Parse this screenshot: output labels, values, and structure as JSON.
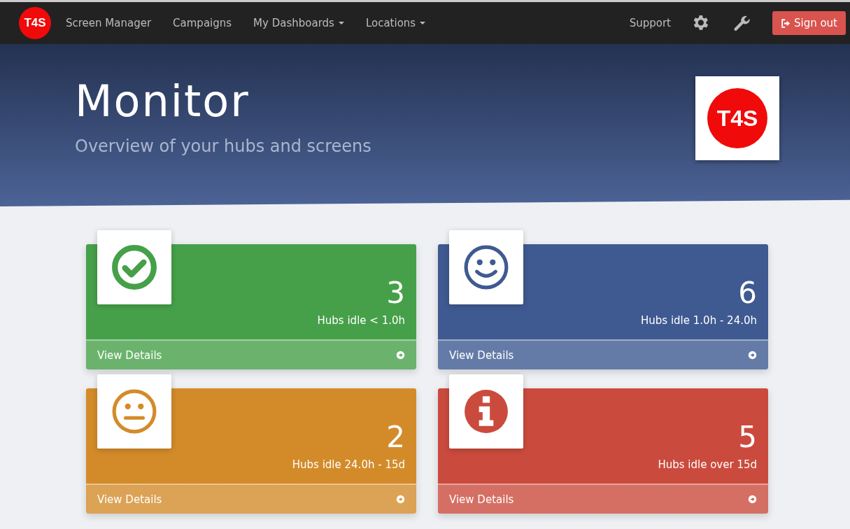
{
  "navbar": {
    "logo": "T4S",
    "items": [
      {
        "label": "Screen Manager",
        "dropdown": false
      },
      {
        "label": "Campaigns",
        "dropdown": false
      },
      {
        "label": "My Dashboards",
        "dropdown": true
      },
      {
        "label": "Locations",
        "dropdown": true
      }
    ],
    "support": "Support",
    "sign_out": "Sign out"
  },
  "hero": {
    "title": "Monitor",
    "subtitle": "Overview of your hubs and screens",
    "logo": "T4S"
  },
  "cards": [
    {
      "kind": "check",
      "color": "#46a049",
      "count": "3",
      "label": "Hubs idle < 1.0h",
      "link": "View Details"
    },
    {
      "kind": "smile",
      "color": "#3f5a91",
      "count": "6",
      "label": "Hubs idle 1.0h - 24.0h",
      "link": "View Details"
    },
    {
      "kind": "neutral",
      "color": "#d38b2a",
      "count": "2",
      "label": "Hubs idle 24.0h - 15d",
      "link": "View Details"
    },
    {
      "kind": "info",
      "color": "#ca4b3d",
      "count": "5",
      "label": "Hubs idle over 15d",
      "link": "View Details"
    }
  ]
}
